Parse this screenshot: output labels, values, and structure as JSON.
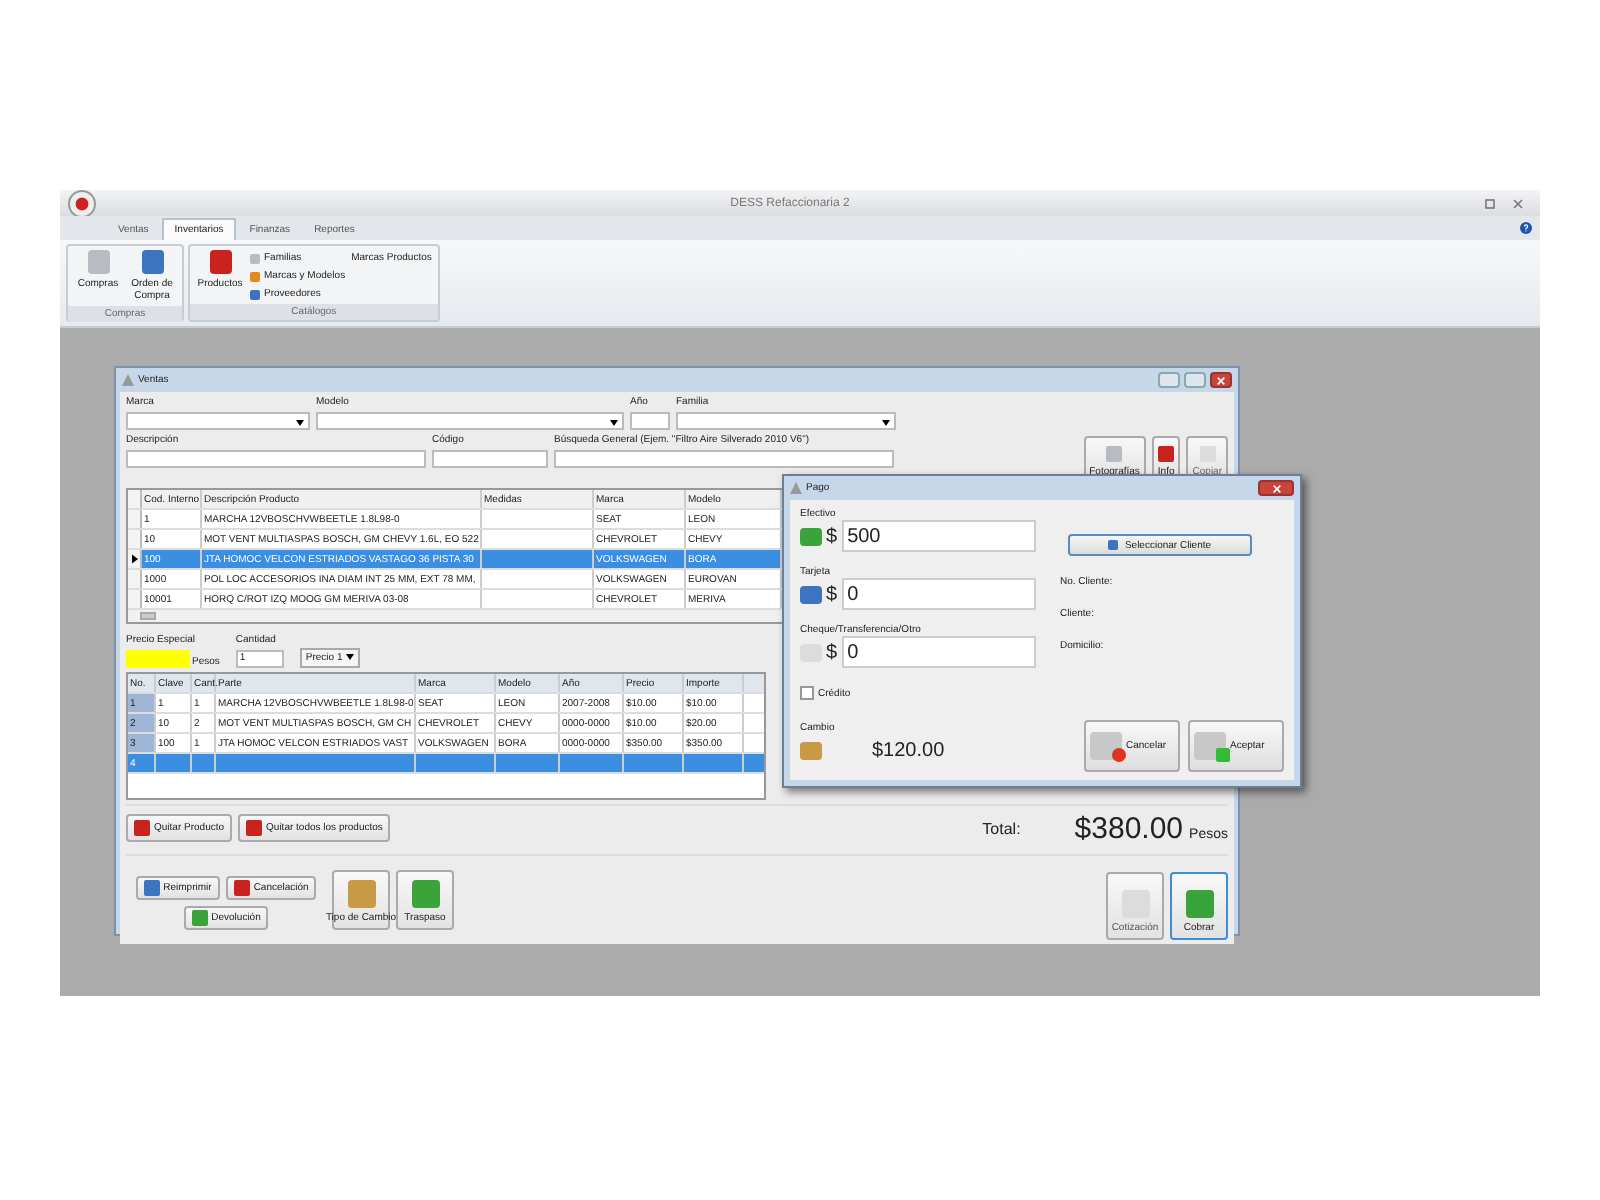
{
  "app": {
    "title": "DESS Refaccionaria 2"
  },
  "tabs": [
    {
      "label": "Ventas",
      "selected": false
    },
    {
      "label": "Inventarios",
      "selected": true
    },
    {
      "label": "Finanzas",
      "selected": false
    },
    {
      "label": "Reportes",
      "selected": false
    }
  ],
  "ribbon": {
    "compras": {
      "title": "Compras",
      "buttons": [
        "Compras",
        "Orden de Compra"
      ]
    },
    "catalogos": {
      "title": "Catálogos",
      "main": "Productos",
      "items": [
        "Familias",
        "Marcas y Modelos",
        "Proveedores"
      ],
      "extra": "Marcas Productos"
    }
  },
  "ventas": {
    "title": "Ventas",
    "filters_row_1": [
      {
        "label": "Marca",
        "kind": "combo"
      },
      {
        "label": "Modelo",
        "kind": "combo"
      },
      {
        "label": "Año",
        "kind": "text"
      },
      {
        "label": "Familia",
        "kind": "combo"
      }
    ],
    "filters_row_2": [
      {
        "label": "Descripción",
        "kind": "text"
      },
      {
        "label": "Código",
        "kind": "text"
      },
      {
        "label": "Búsqueda General (Ejem. \"Filtro Aire Silverado 2010 V6\")",
        "kind": "text"
      }
    ],
    "tool_buttons": [
      {
        "label": "Fotografías",
        "disabled": false
      },
      {
        "label": "Info",
        "disabled": false
      },
      {
        "label": "Copiar",
        "disabled": true
      }
    ],
    "products": {
      "columns": [
        "Cod. Interno",
        "Descripción Producto",
        "Medidas",
        "Marca",
        "Modelo"
      ],
      "rows": [
        {
          "selected": false,
          "cells": [
            "1",
            "MARCHA 12VBOSCHVWBEETLE 1.8L98-0",
            "",
            "SEAT",
            "LEON"
          ]
        },
        {
          "selected": false,
          "cells": [
            "10",
            "MOT VENT MULTIASPAS BOSCH, GM CHEVY 1.6L, EO 522",
            "",
            "CHEVROLET",
            "CHEVY"
          ]
        },
        {
          "selected": true,
          "cells": [
            "100",
            "JTA HOMOC VELCON ESTRIADOS VASTAGO 36 PISTA 30",
            "",
            "VOLKSWAGEN",
            "BORA"
          ]
        },
        {
          "selected": false,
          "cells": [
            "1000",
            "POL LOC ACCESORIOS INA DIAM INT 25 MM, EXT 78 MM,",
            "",
            "VOLKSWAGEN",
            "EUROVAN"
          ]
        },
        {
          "selected": false,
          "cells": [
            "10001",
            "HORQ C/ROT IZQ MOOG GM MERIVA 03-08",
            "",
            "CHEVROLET",
            "MERIVA"
          ]
        }
      ]
    },
    "price": {
      "special_label": "Precio Especial",
      "unit": "Pesos",
      "qty_label": "Cantidad",
      "qty": "1",
      "price_list": "Precio 1"
    },
    "cart": {
      "columns": [
        "No.",
        "Clave",
        "Cant.",
        "Parte",
        "Marca",
        "Modelo",
        "Año",
        "Precio",
        "Importe"
      ],
      "rows": [
        {
          "selected": false,
          "cells": [
            "1",
            "1",
            "1",
            "MARCHA 12VBOSCHVWBEETLE 1.8L98-0",
            "SEAT",
            "LEON",
            "2007-2008",
            "$10.00",
            "$10.00"
          ]
        },
        {
          "selected": false,
          "cells": [
            "2",
            "10",
            "2",
            "MOT VENT MULTIASPAS BOSCH, GM CH",
            "CHEVROLET",
            "CHEVY",
            "0000-0000",
            "$10.00",
            "$20.00"
          ]
        },
        {
          "selected": false,
          "cells": [
            "3",
            "100",
            "1",
            "JTA HOMOC VELCON ESTRIADOS VAST",
            "VOLKSWAGEN",
            "BORA",
            "0000-0000",
            "$350.00",
            "$350.00"
          ]
        },
        {
          "selected": true,
          "cells": [
            "4",
            "",
            "",
            "",
            "",
            "",
            "",
            "",
            ""
          ]
        }
      ]
    },
    "remove_buttons": [
      "Quitar Producto",
      "Quitar todos los productos"
    ],
    "total": {
      "label": "Total:",
      "value": "$380.00",
      "unit": "Pesos"
    },
    "bottom_buttons": [
      {
        "label": "Reimprimir",
        "kind": "small"
      },
      {
        "label": "Cancelación",
        "kind": "small"
      },
      {
        "label": "Devolución",
        "kind": "small"
      },
      {
        "label": "Tipo de Cambio",
        "kind": "large"
      },
      {
        "label": "Traspaso",
        "kind": "large"
      }
    ],
    "right_buttons": [
      {
        "label": "Cotización",
        "disabled": true,
        "highlighted": false
      },
      {
        "label": "Cobrar",
        "disabled": false,
        "highlighted": true
      }
    ]
  },
  "pago": {
    "title": "Pago",
    "fields": [
      {
        "label": "Efectivo",
        "symbol": "$",
        "value": "500"
      },
      {
        "label": "Tarjeta",
        "symbol": "$",
        "value": "0"
      },
      {
        "label": "Cheque/Transferencia/Otro",
        "symbol": "$",
        "value": "0"
      }
    ],
    "credit": {
      "label": "Crédito",
      "checked": false
    },
    "change": {
      "label": "Cambio",
      "value": "$120.00"
    },
    "select_client": "Seleccionar Cliente",
    "client_labels": [
      "No. Cliente:",
      "Cliente:",
      "Domicilio:"
    ],
    "buttons": [
      {
        "label": "Cancelar",
        "kind": "cancel"
      },
      {
        "label": "Aceptar",
        "kind": "accept"
      }
    ]
  }
}
